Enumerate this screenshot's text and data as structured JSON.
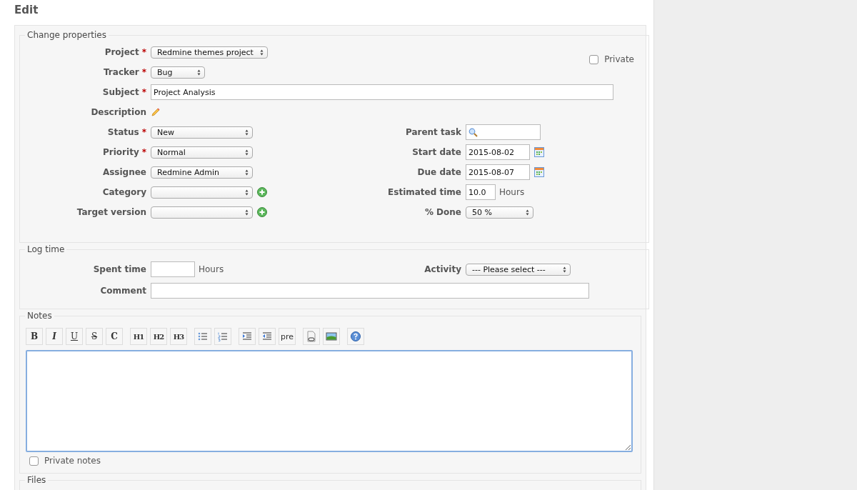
{
  "page_title": "Edit",
  "properties": {
    "legend": "Change properties",
    "private": {
      "label": "Private",
      "checked": false
    },
    "top_fields": [
      {
        "label": "Project",
        "required_mark": "*",
        "kind": "select",
        "value": "Redmine themes project"
      },
      {
        "label": "Tracker",
        "required_mark": "*",
        "kind": "select",
        "value": "Bug"
      },
      {
        "label": "Subject",
        "required_mark": "*",
        "kind": "text",
        "value": "Project Analysis"
      },
      {
        "label": "Description",
        "kind": "edit"
      }
    ],
    "left_fields": [
      {
        "label": "Status",
        "required_mark": "*",
        "kind": "select",
        "value": "New"
      },
      {
        "label": "Priority",
        "required_mark": "*",
        "kind": "select",
        "value": "Normal"
      },
      {
        "label": "Assignee",
        "kind": "select",
        "value": "Redmine Admin"
      },
      {
        "label": "Category",
        "kind": "select-add"
      },
      {
        "label": "Target version",
        "kind": "select-add"
      }
    ],
    "right_fields": [
      {
        "label": "Parent task",
        "kind": "search"
      },
      {
        "label": "Start date",
        "kind": "date",
        "value": "2015-08-02"
      },
      {
        "label": "Due date",
        "kind": "date",
        "value": "2015-08-07"
      },
      {
        "label": "Estimated time",
        "kind": "hours",
        "value": "10.0",
        "unit": "Hours"
      },
      {
        "label": "% Done",
        "kind": "select",
        "value": "50 %"
      }
    ]
  },
  "log_time": {
    "legend": "Log time",
    "spent_time": {
      "label": "Spent time",
      "unit": "Hours"
    },
    "activity": {
      "label": "Activity",
      "value": "--- Please select ---"
    },
    "comment": {
      "label": "Comment"
    }
  },
  "notes": {
    "legend": "Notes",
    "toolbar": [
      {
        "kind": "bold",
        "label": "B"
      },
      {
        "kind": "italic",
        "label": "I"
      },
      {
        "kind": "underline",
        "label": "U"
      },
      {
        "kind": "strike",
        "label": "S"
      },
      {
        "kind": "code",
        "label": "C"
      },
      {
        "kind": "heading",
        "label": "H1"
      },
      {
        "kind": "heading",
        "label": "H2"
      },
      {
        "kind": "heading",
        "label": "H3"
      },
      {
        "kind": "ul"
      },
      {
        "kind": "ol"
      },
      {
        "kind": "indent"
      },
      {
        "kind": "outdent"
      },
      {
        "kind": "pre",
        "label": "pre"
      },
      {
        "kind": "link"
      },
      {
        "kind": "image"
      },
      {
        "kind": "help"
      }
    ],
    "private_notes": {
      "label": "Private notes",
      "checked": false
    }
  },
  "files": {
    "legend": "Files"
  }
}
